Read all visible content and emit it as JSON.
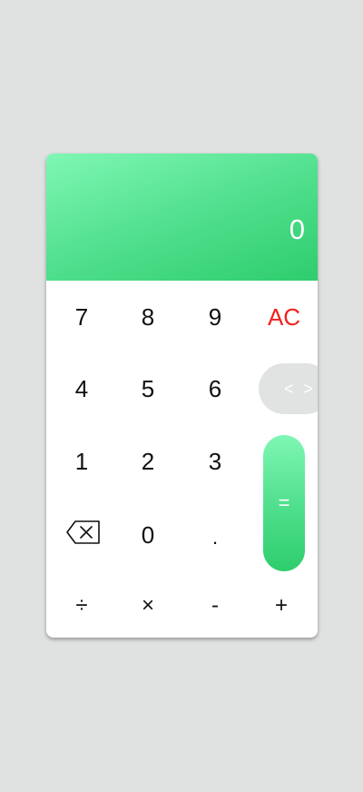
{
  "display": {
    "value": "0"
  },
  "keys": {
    "seven": "7",
    "eight": "8",
    "nine": "9",
    "clear": "AC",
    "four": "4",
    "five": "5",
    "six": "6",
    "toggle": "< >",
    "one": "1",
    "two": "2",
    "three": "3",
    "zero": "0",
    "dot": ".",
    "divide": "÷",
    "multiply": "×",
    "subtract": "-",
    "add": "+",
    "equals": "=",
    "backspace_icon": "backspace-icon"
  },
  "colors": {
    "accent_light": "#7ff7b4",
    "accent_dark": "#2ecd6d",
    "clear": "#f2211e",
    "background": "#e0e2e1",
    "toggle_bg": "#e1e2e2"
  }
}
